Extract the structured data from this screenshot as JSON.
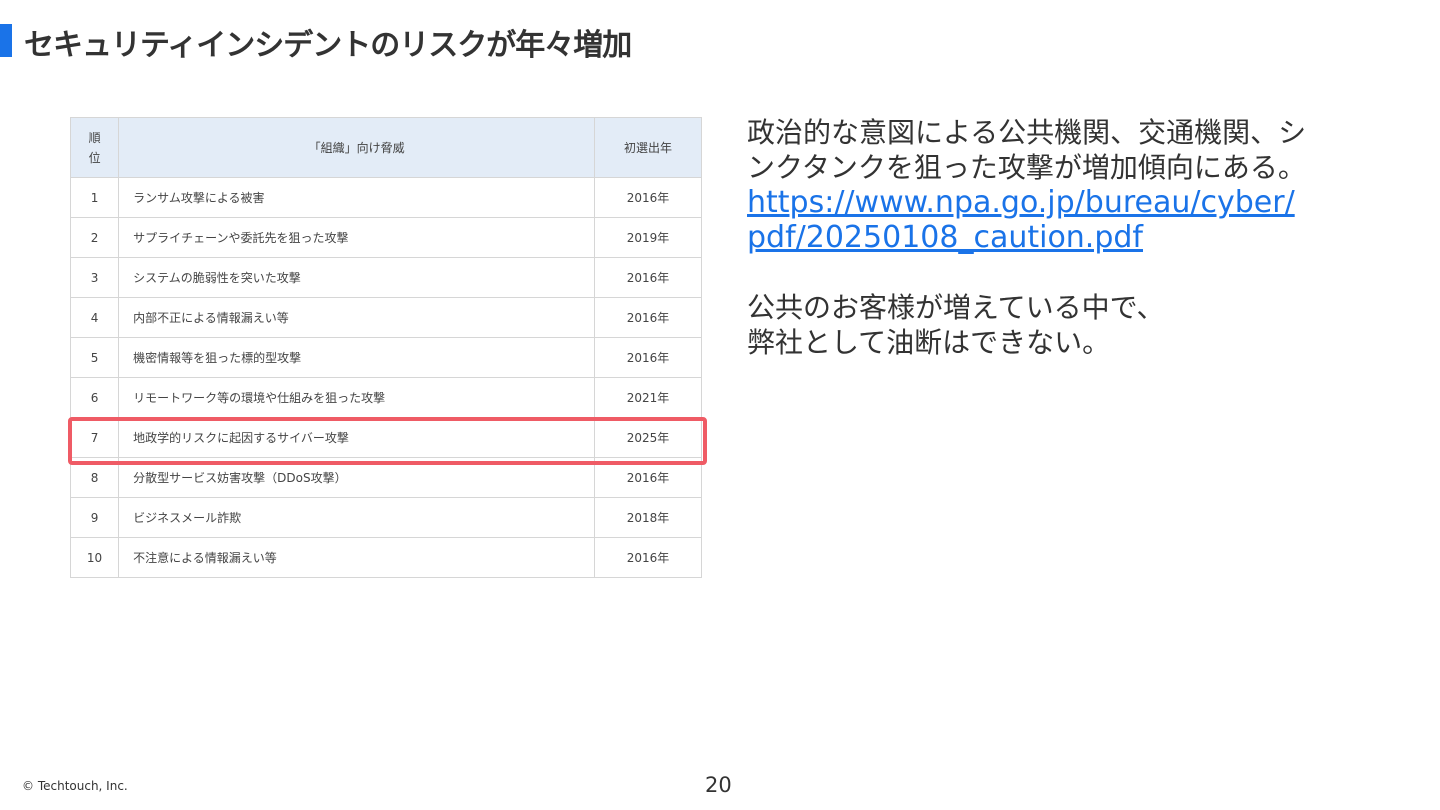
{
  "header": {
    "title": "セキュリティインシデントのリスクが年々増加",
    "accent_color": "#1a73e8"
  },
  "table": {
    "columns": {
      "rank": "順位",
      "threat": "「組織」向け脅威",
      "year": "初選出年"
    },
    "rows": [
      {
        "rank": "1",
        "threat": "ランサム攻撃による被害",
        "year": "2016年"
      },
      {
        "rank": "2",
        "threat": "サプライチェーンや委託先を狙った攻撃",
        "year": "2019年"
      },
      {
        "rank": "3",
        "threat": "システムの脆弱性を突いた攻撃",
        "year": "2016年"
      },
      {
        "rank": "4",
        "threat": "内部不正による情報漏えい等",
        "year": "2016年"
      },
      {
        "rank": "5",
        "threat": "機密情報等を狙った標的型攻撃",
        "year": "2016年"
      },
      {
        "rank": "6",
        "threat": "リモートワーク等の環境や仕組みを狙った攻撃",
        "year": "2021年"
      },
      {
        "rank": "7",
        "threat": "地政学的リスクに起因するサイバー攻撃",
        "year": "2025年"
      },
      {
        "rank": "8",
        "threat": "分散型サービス妨害攻撃（DDoS攻撃）",
        "year": "2016年"
      },
      {
        "rank": "9",
        "threat": "ビジネスメール詐欺",
        "year": "2018年"
      },
      {
        "rank": "10",
        "threat": "不注意による情報漏えい等",
        "year": "2016年"
      }
    ],
    "highlight_color": "#ef5b65",
    "header_bg": "#e3ecf7"
  },
  "body": {
    "paragraph1": "政治的な意図による公共機関、交通機関、シンクタンクを狙った攻撃が増加傾向にある。",
    "link": "https://www.npa.go.jp/bureau/cyber/pdf/20250108_caution.pdf",
    "paragraph2_line1": "公共のお客様が増えている中で、",
    "paragraph2_line2": "弊社として油断はできない。"
  },
  "footer": {
    "copyright": "© Techtouch, Inc.",
    "page_number": "20"
  }
}
